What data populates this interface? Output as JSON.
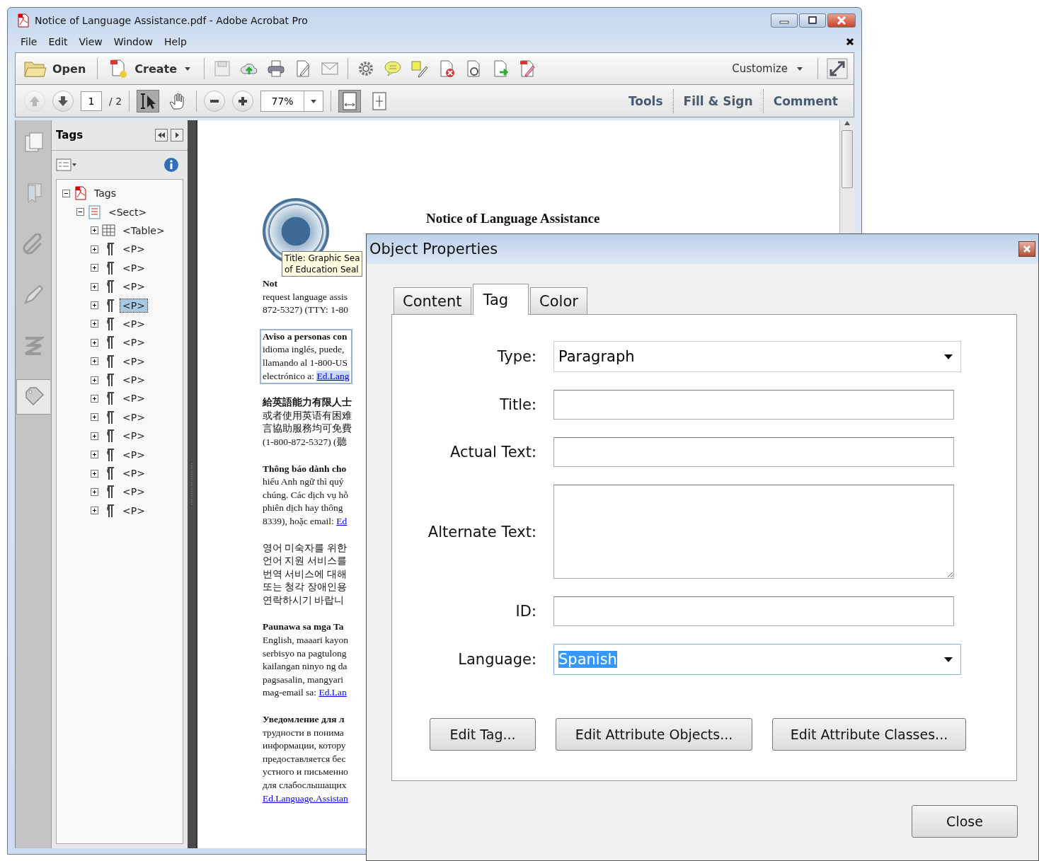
{
  "window": {
    "title": "Notice of Language Assistance.pdf - Adobe Acrobat Pro"
  },
  "menu": [
    "File",
    "Edit",
    "View",
    "Window",
    "Help"
  ],
  "toolbar": {
    "open": "Open",
    "create": "Create",
    "customize": "Customize"
  },
  "navbar": {
    "prev_disabled": true,
    "page": "1",
    "page_total": "/ 2",
    "zoom": "77%",
    "tools": [
      {
        "kind": "select",
        "selected": true
      },
      {
        "kind": "hand",
        "selected": false
      }
    ],
    "panes": [
      "Tools",
      "Fill & Sign",
      "Comment"
    ]
  },
  "side_tabs": [
    {
      "kind": "pages",
      "selected": false
    },
    {
      "kind": "bookmarks",
      "selected": false
    },
    {
      "kind": "attachments",
      "selected": false
    },
    {
      "kind": "signatures",
      "selected": false
    },
    {
      "kind": "content",
      "selected": false
    },
    {
      "kind": "tags",
      "selected": true
    }
  ],
  "tags_panel": {
    "title": "Tags",
    "tree": [
      {
        "label": "Tags",
        "kind": "root",
        "expanded": true,
        "selected": false,
        "children": [
          {
            "label": "<Sect>",
            "kind": "sect",
            "expanded": true,
            "selected": false,
            "children": [
              {
                "label": "<Table>",
                "kind": "table",
                "expanded": false,
                "selected": false
              },
              {
                "label": "<P>",
                "kind": "p",
                "expanded": false,
                "selected": false
              },
              {
                "label": "<P>",
                "kind": "p",
                "expanded": false,
                "selected": false
              },
              {
                "label": "<P>",
                "kind": "p",
                "expanded": false,
                "selected": false
              },
              {
                "label": "<P>",
                "kind": "p",
                "expanded": false,
                "selected": true
              },
              {
                "label": "<P>",
                "kind": "p",
                "expanded": false,
                "selected": false
              },
              {
                "label": "<P>",
                "kind": "p",
                "expanded": false,
                "selected": false
              },
              {
                "label": "<P>",
                "kind": "p",
                "expanded": false,
                "selected": false
              },
              {
                "label": "<P>",
                "kind": "p",
                "expanded": false,
                "selected": false
              },
              {
                "label": "<P>",
                "kind": "p",
                "expanded": false,
                "selected": false
              },
              {
                "label": "<P>",
                "kind": "p",
                "expanded": false,
                "selected": false
              },
              {
                "label": "<P>",
                "kind": "p",
                "expanded": false,
                "selected": false
              },
              {
                "label": "<P>",
                "kind": "p",
                "expanded": false,
                "selected": false
              },
              {
                "label": "<P>",
                "kind": "p",
                "expanded": false,
                "selected": false
              },
              {
                "label": "<P>",
                "kind": "p",
                "expanded": false,
                "selected": false
              },
              {
                "label": "<P>",
                "kind": "p",
                "expanded": false,
                "selected": false
              }
            ]
          }
        ]
      }
    ]
  },
  "document": {
    "title": "Notice of Language Assistance",
    "tooltip": [
      "Title: Graphic Sea",
      "of Education Seal"
    ],
    "paragraphs": [
      {
        "lines": [
          "Not",
          "request language assis",
          "872-5327) (TTY: 1-80"
        ],
        "bold_first": true,
        "highlighted": false
      },
      {
        "lines": [
          "Aviso a personas con",
          "idioma inglés, puede,",
          "llamando al 1-800-US",
          {
            "text": "electrónico a: ",
            "link": "Ed.Lang"
          }
        ],
        "bold_first": true,
        "highlighted": true
      },
      {
        "lines": [
          "給英語能力有限人士",
          "或者使用英语有困难",
          "言協助服務均可免費",
          "(1-800-872-5327) (聽"
        ],
        "bold_first": true,
        "highlighted": false
      },
      {
        "lines": [
          "Thông báo dành cho",
          "hiểu Anh ngữ thì quý",
          "chúng. Các dịch vụ hỗ",
          "phiên dịch hay thông",
          {
            "text": "8339), hoặc email: ",
            "link": "Ed"
          }
        ],
        "bold_first": true,
        "highlighted": false
      },
      {
        "lines": [
          "영어 미숙자를 위한",
          "언어 지원 서비스를",
          "번역 서비스에 대해",
          "또는 청각 장애인용",
          "연락하시기 바랍니"
        ],
        "bold_first": false,
        "highlighted": false
      },
      {
        "lines": [
          "Paunawa sa mga Ta",
          "English, maaari kayon",
          "serbisyo na pagtulong",
          "kailangan ninyo ng da",
          "pagsasalin, mangyari",
          {
            "text": "mag-email sa: ",
            "link": "Ed.Lan"
          }
        ],
        "bold_first": true,
        "highlighted": false
      },
      {
        "lines": [
          "Уведомление для л",
          "трудности в понима",
          "информации, котору",
          "предоставляется бес",
          "устного и письменно",
          "для слабослышащих",
          {
            "link": "Ed.Language.Assistan"
          }
        ],
        "bold_first": true,
        "highlighted": false
      }
    ]
  },
  "dialog": {
    "title": "Object Properties",
    "tabs": [
      {
        "label": "Content",
        "selected": false
      },
      {
        "label": "Tag",
        "selected": true
      },
      {
        "label": "Color",
        "selected": false
      }
    ],
    "fields": [
      {
        "label": "Type:",
        "kind": "dropdown",
        "value": "Paragraph",
        "focused": false
      },
      {
        "label": "Title:",
        "kind": "text",
        "focused": false
      },
      {
        "label": "Actual Text:",
        "kind": "text",
        "focused": false
      },
      {
        "label": "Alternate Text:",
        "kind": "textarea",
        "focused": false
      },
      {
        "label": "ID:",
        "kind": "text",
        "focused": false
      },
      {
        "label": "Language:",
        "kind": "dropdown",
        "value": "Spanish",
        "focused": true
      }
    ],
    "buttons": [
      "Edit Tag...",
      "Edit Attribute Objects...",
      "Edit Attribute Classes..."
    ],
    "close": "Close"
  }
}
